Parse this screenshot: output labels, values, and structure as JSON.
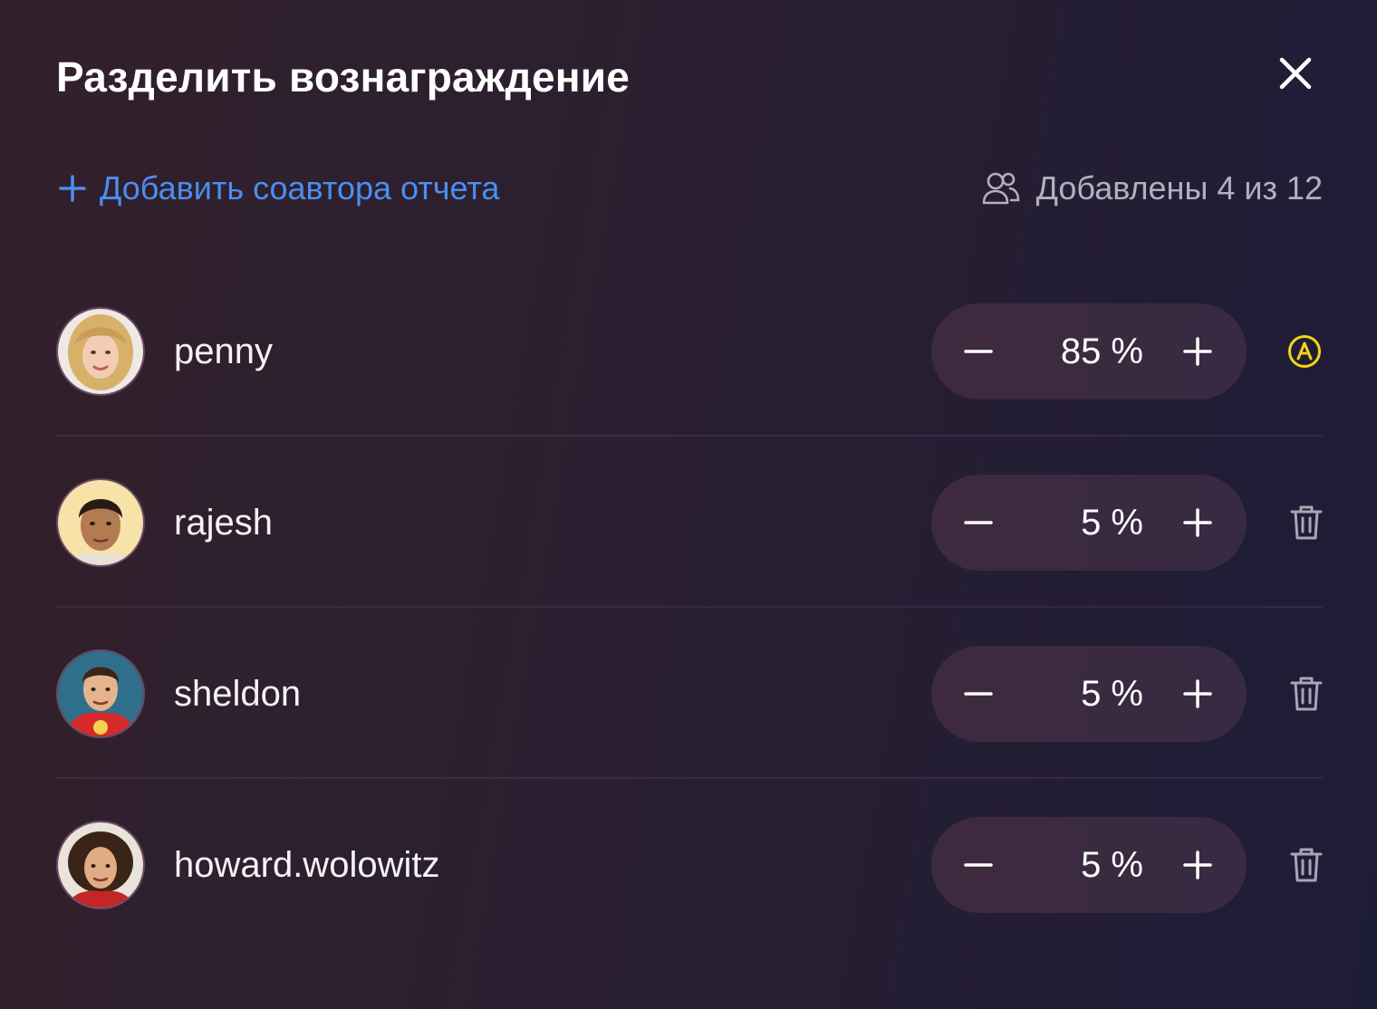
{
  "dialog": {
    "title": "Разделить вознаграждение"
  },
  "toolbar": {
    "add_coauthor_label": "Добавить соавтора отчета",
    "counter_label": "Добавлены 4 из 12"
  },
  "icons": {
    "close": "close-icon",
    "add": "plus-icon",
    "users": "users-icon",
    "author": "author-badge-icon",
    "delete": "trash-icon",
    "decrement": "minus-icon",
    "increment": "plus-icon"
  },
  "colors": {
    "accent_link": "#4b8ef1",
    "author_badge": "#f0d419"
  },
  "participants": [
    {
      "username": "penny",
      "share": "85 %",
      "action": "author-badge"
    },
    {
      "username": "rajesh",
      "share": "5 %",
      "action": "delete"
    },
    {
      "username": "sheldon",
      "share": "5 %",
      "action": "delete"
    },
    {
      "username": "howard.wolowitz",
      "share": "5 %",
      "action": "delete"
    }
  ]
}
